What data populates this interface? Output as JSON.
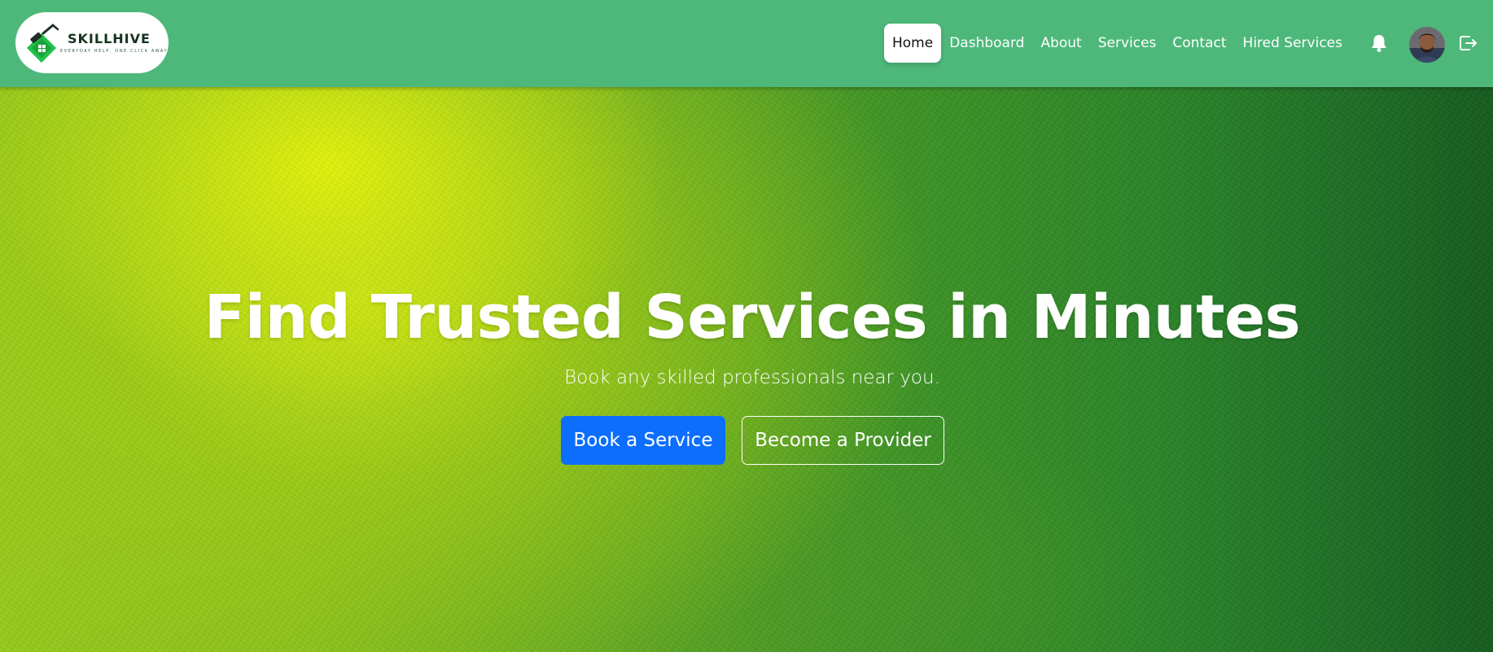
{
  "brand": {
    "name": "SKILLHIVE",
    "tagline": "EVERYDAY HELP, ONE CLICK AWAY"
  },
  "nav": {
    "items": [
      {
        "label": "Home",
        "active": true
      },
      {
        "label": "Dashboard",
        "active": false
      },
      {
        "label": "About",
        "active": false
      },
      {
        "label": "Services",
        "active": false
      },
      {
        "label": "Contact",
        "active": false
      },
      {
        "label": "Hired Services",
        "active": false
      }
    ]
  },
  "header_icons": [
    "bell-icon",
    "avatar",
    "logout-icon"
  ],
  "hero": {
    "title": "Find Trusted Services in Minutes",
    "subtitle": "Book any skilled professionals near you.",
    "primary_button": "Book a Service",
    "secondary_button": "Become a Provider"
  },
  "colors": {
    "navbar": "#4db87a",
    "primary_button": "#0d6efd",
    "hero_light": "#d9ee0c",
    "hero_dark": "#155a1e"
  }
}
